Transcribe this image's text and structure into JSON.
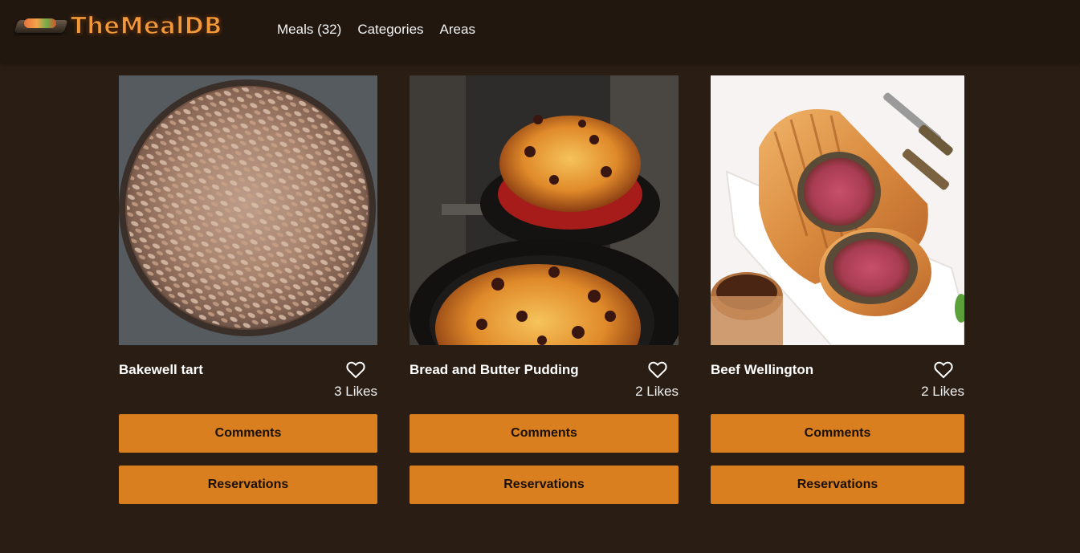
{
  "header": {
    "logo_text": "TheMealDB",
    "nav": {
      "meals": "Meals (32)",
      "categories": "Categories",
      "areas": "Areas"
    }
  },
  "cards": [
    {
      "title": "Bakewell tart",
      "likes": "3 Likes",
      "comments_label": "Comments",
      "reservations_label": "Reservations",
      "image": "bakewell-tart-photo"
    },
    {
      "title": "Bread and Butter Pudding",
      "likes": "2 Likes",
      "comments_label": "Comments",
      "reservations_label": "Reservations",
      "image": "bread-and-butter-pudding-photo"
    },
    {
      "title": "Beef Wellington",
      "likes": "2 Likes",
      "comments_label": "Comments",
      "reservations_label": "Reservations",
      "image": "beef-wellington-photo"
    }
  ],
  "colors": {
    "background": "#2a1d13",
    "navbar": "#21170f",
    "button": "#d97f1f",
    "logo": "#f29a3a"
  }
}
